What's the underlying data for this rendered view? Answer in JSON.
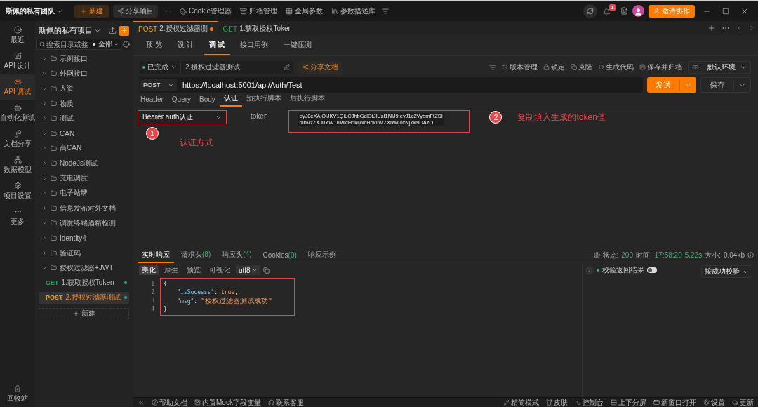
{
  "top_bar": {
    "team": "斯佩的私有团队",
    "new_button": "新建",
    "share_button": "分享项目",
    "more": "···",
    "tools": [
      {
        "kind": "cookie",
        "label": "Cookie管理器"
      },
      {
        "kind": "archive",
        "label": "归档管理"
      },
      {
        "kind": "params",
        "label": "全局参数"
      },
      {
        "kind": "library",
        "label": "参数描述库"
      }
    ],
    "notification_count": "1",
    "invite_button": "邀请协作"
  },
  "rail": {
    "items": [
      {
        "kind": "recent",
        "label": "最近",
        "selected": false
      },
      {
        "kind": "design",
        "label": "API 设计",
        "selected": false
      },
      {
        "kind": "debug",
        "label": "API 调试",
        "selected": true
      },
      {
        "kind": "auto",
        "label": "自动化测试",
        "selected": false
      },
      {
        "kind": "docs",
        "label": "文档分享",
        "selected": false
      },
      {
        "kind": "model",
        "label": "数据模型",
        "selected": false
      },
      {
        "kind": "settings",
        "label": "项目设置",
        "selected": false
      },
      {
        "kind": "more",
        "label": "更多",
        "selected": false
      }
    ],
    "bottom": "回收站"
  },
  "sidebar": {
    "project": "斯佩的私有项目",
    "search": {
      "placeholder": "搜索目录或接"
    },
    "filter": "全部",
    "tree": [
      {
        "label": "示例接口",
        "expanded": false
      },
      {
        "label": "外网接口",
        "expanded": true
      },
      {
        "label": "人资",
        "expanded": true
      },
      {
        "label": "物质",
        "expanded": false
      },
      {
        "label": "测试",
        "expanded": false
      },
      {
        "label": "CAN",
        "expanded": false
      },
      {
        "label": "高CAN",
        "expanded": false
      },
      {
        "label": "NodeJs测试",
        "expanded": false
      },
      {
        "label": "充电调度",
        "expanded": false
      },
      {
        "label": "电子站牌",
        "expanded": false
      },
      {
        "label": "信息发布对外文档",
        "expanded": false
      },
      {
        "label": "调度终端酒精检测",
        "expanded": false
      },
      {
        "label": "Identity4",
        "expanded": false
      },
      {
        "label": "验证码",
        "expanded": false
      },
      {
        "label": "授权过滤器+JWT",
        "expanded": true,
        "children": [
          {
            "method": "GET",
            "color": "#1fa55a",
            "label": "1.获取授权Token",
            "selected": false
          },
          {
            "method": "POST",
            "color": "#e8a21a",
            "label": "2.授权过滤器测试",
            "selected": true
          }
        ]
      }
    ],
    "new_button": "新建"
  },
  "tabs": [
    {
      "method": "POST",
      "color": "#e8a21a",
      "title": "2.授权过滤器测",
      "selected": true,
      "unsaved": true
    },
    {
      "method": "GET",
      "color": "#1fa55a",
      "title": "1.获取授权Toker",
      "selected": false,
      "unsaved": false
    }
  ],
  "view_tabs": [
    {
      "label": "预 览",
      "selected": false
    },
    {
      "label": "设 计",
      "selected": false
    },
    {
      "label": "调 试",
      "selected": true
    },
    {
      "label": "接口用例",
      "selected": false
    },
    {
      "label": "一键压测",
      "selected": false
    }
  ],
  "request": {
    "status": "已完成",
    "name": "2.授权过滤器测试",
    "share_doc": "分享文档",
    "actions": [
      {
        "kind": "version",
        "label": "版本管理"
      },
      {
        "kind": "lock",
        "label": "锁定"
      },
      {
        "kind": "clone",
        "label": "克隆"
      },
      {
        "kind": "code",
        "label": "生成代码"
      },
      {
        "kind": "save-archive",
        "label": "保存并归档"
      }
    ],
    "environment": "默认环境",
    "method": "POST",
    "url": "https://localhost:5001/api/Auth/Test",
    "send": "发送",
    "save": "保存",
    "param_tabs": [
      {
        "label": "Header",
        "selected": false
      },
      {
        "label": "Query",
        "selected": false
      },
      {
        "label": "Body",
        "selected": false
      },
      {
        "label": "认证",
        "selected": true
      },
      {
        "label": "预执行脚本",
        "selected": false
      },
      {
        "label": "后执行脚本",
        "selected": false
      }
    ],
    "auth_type": {
      "value": "Bearer auth认证",
      "highlighted": true
    },
    "token": {
      "label": "token",
      "lines": [
        "eyJ0eXAiOiJKV1QiLCJhbGciOiJIUzI1NiJ9.eyJ1c2VybmFtZSI",
        "6InVzZXJuYW1lIiwicHdkIjoicHdkIiwiZXhwIjoxNjkxNDAzO"
      ],
      "highlighted": true
    },
    "annotations": [
      {
        "number": "1",
        "text": "认证方式"
      },
      {
        "number": "2",
        "text": "复制填入生成的token值"
      }
    ]
  },
  "response": {
    "tabs": [
      {
        "label": "实时响应",
        "selected": true
      },
      {
        "label": "请求头",
        "count": "(8)",
        "selected": false
      },
      {
        "label": "响应头",
        "count": "(4)",
        "selected": false
      },
      {
        "label": "Cookies",
        "count": "(0)",
        "selected": false
      },
      {
        "label": "响应示例",
        "selected": false
      }
    ],
    "status_label": "状态:",
    "status": "200",
    "time_label": "时间:",
    "time": "17:58:20",
    "duration": "5.22s",
    "size_label": "大小:",
    "size": "0.04kb",
    "views": [
      {
        "label": "美化",
        "selected": true
      },
      {
        "label": "原生",
        "selected": false
      },
      {
        "label": "预览",
        "selected": false
      },
      {
        "label": "可视化",
        "selected": false
      }
    ],
    "encoding": "utf8",
    "code": {
      "highlighted": true,
      "lines": [
        {
          "number": "1",
          "tokens": [
            {
              "kind": "punct",
              "text": "{"
            }
          ]
        },
        {
          "number": "2",
          "tokens": [
            {
              "kind": "key",
              "text": "    \"isSucesss\""
            },
            {
              "kind": "punct",
              "text": ": "
            },
            {
              "kind": "literal",
              "text": "true"
            },
            {
              "kind": "punct",
              "text": ","
            }
          ]
        },
        {
          "number": "3",
          "tokens": [
            {
              "kind": "key",
              "text": "    \"msg\""
            },
            {
              "kind": "punct",
              "text": ": "
            },
            {
              "kind": "string",
              "text": "\"授权过滤器测试成功\""
            }
          ]
        },
        {
          "number": "4",
          "tokens": [
            {
              "kind": "punct",
              "text": "}"
            }
          ]
        }
      ]
    },
    "check": {
      "label": "校验返回结果",
      "on": false
    },
    "check_mode": "按成功校验"
  },
  "bottom_bar": {
    "left": [
      {
        "kind": "help",
        "label": "帮助文档"
      },
      {
        "kind": "mock",
        "label": "内置Mock字段变量"
      },
      {
        "kind": "support",
        "label": "联系客服"
      }
    ],
    "right": [
      {
        "kind": "compact",
        "label": "精简模式"
      },
      {
        "kind": "skin",
        "label": "皮肤"
      },
      {
        "kind": "console",
        "label": "控制台"
      },
      {
        "kind": "split",
        "label": "上下分屏"
      },
      {
        "kind": "window",
        "label": "新窗口打开"
      },
      {
        "kind": "settings",
        "label": "设置"
      },
      {
        "kind": "update",
        "label": "更新"
      }
    ]
  }
}
